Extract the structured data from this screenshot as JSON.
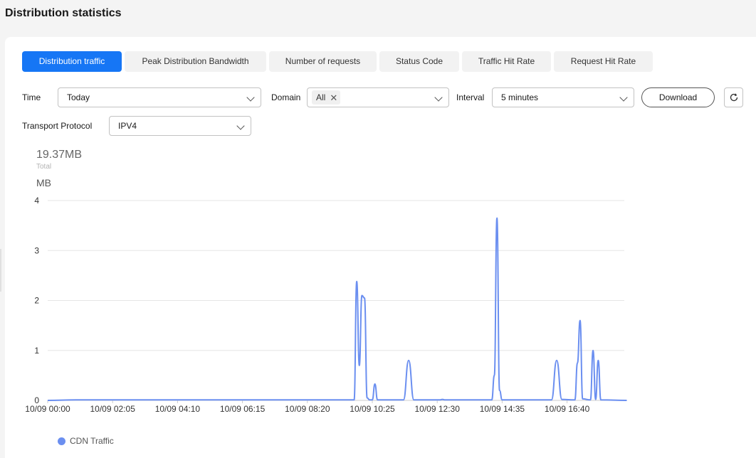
{
  "page": {
    "title": "Distribution statistics"
  },
  "tabs": [
    {
      "label": "Distribution traffic",
      "active": true
    },
    {
      "label": "Peak Distribution Bandwidth",
      "active": false
    },
    {
      "label": "Number of requests",
      "active": false
    },
    {
      "label": "Status Code",
      "active": false
    },
    {
      "label": "Traffic Hit Rate",
      "active": false
    },
    {
      "label": "Request Hit Rate",
      "active": false
    }
  ],
  "filters": {
    "time": {
      "label": "Time",
      "value": "Today"
    },
    "domain": {
      "label": "Domain",
      "chip": "All"
    },
    "interval": {
      "label": "Interval",
      "value": "5 minutes"
    },
    "transport": {
      "label": "Transport Protocol",
      "value": "IPV4"
    },
    "download_label": "Download"
  },
  "summary": {
    "total_value": "19.37MB",
    "total_label": "Total",
    "unit": "MB"
  },
  "colors": {
    "accent": "#1676f5",
    "series": "#6b8ff0"
  },
  "chart_data": {
    "type": "line",
    "ylim": [
      0,
      4
    ],
    "yticks": [
      "0",
      "1",
      "2",
      "3",
      "4"
    ],
    "xticks": [
      "10/09 00:00",
      "10/09 02:05",
      "10/09 04:10",
      "10/09 06:15",
      "10/09 08:20",
      "10/09 10:25",
      "10/09 12:30",
      "10/09 14:35",
      "10/09 16:40"
    ],
    "x_interval_minutes": 5,
    "series": [
      {
        "name": "CDN Traffic",
        "points": [
          [
            "10/09 00:00",
            0
          ],
          [
            "10/09 00:55",
            0.01
          ],
          [
            "10/09 03:45",
            0.01
          ],
          [
            "10/09 04:30",
            0.01
          ],
          [
            "10/09 05:30",
            0.01
          ],
          [
            "10/09 06:50",
            0.01
          ],
          [
            "10/09 09:50",
            0.01
          ],
          [
            "10/09 09:55",
            2.38
          ],
          [
            "10/09 10:00",
            0.7
          ],
          [
            "10/09 10:05",
            2.1
          ],
          [
            "10/09 10:10",
            2.05
          ],
          [
            "10/09 10:15",
            0.05
          ],
          [
            "10/09 10:20",
            0.01
          ],
          [
            "10/09 10:25",
            0.01
          ],
          [
            "10/09 10:30",
            0.33
          ],
          [
            "10/09 10:35",
            0.01
          ],
          [
            "10/09 11:25",
            0.01
          ],
          [
            "10/09 11:35",
            0.8
          ],
          [
            "10/09 11:45",
            0.01
          ],
          [
            "10/09 12:35",
            0.01
          ],
          [
            "10/09 12:40",
            0.02
          ],
          [
            "10/09 12:45",
            0.01
          ],
          [
            "10/09 14:15",
            0.01
          ],
          [
            "10/09 14:20",
            0.5
          ],
          [
            "10/09 14:25",
            3.65
          ],
          [
            "10/09 14:30",
            0.2
          ],
          [
            "10/09 14:35",
            0.01
          ],
          [
            "10/09 16:10",
            0.01
          ],
          [
            "10/09 16:20",
            0.8
          ],
          [
            "10/09 16:30",
            0.02
          ],
          [
            "10/09 16:55",
            0.01
          ],
          [
            "10/09 17:00",
            0.75
          ],
          [
            "10/09 17:05",
            1.6
          ],
          [
            "10/09 17:10",
            0.03
          ],
          [
            "10/09 17:25",
            0.01
          ],
          [
            "10/09 17:30",
            1.0
          ],
          [
            "10/09 17:35",
            0.02
          ],
          [
            "10/09 17:40",
            0.8
          ],
          [
            "10/09 17:45",
            0.01
          ],
          [
            "10/09 18:35",
            0
          ]
        ]
      }
    ]
  }
}
